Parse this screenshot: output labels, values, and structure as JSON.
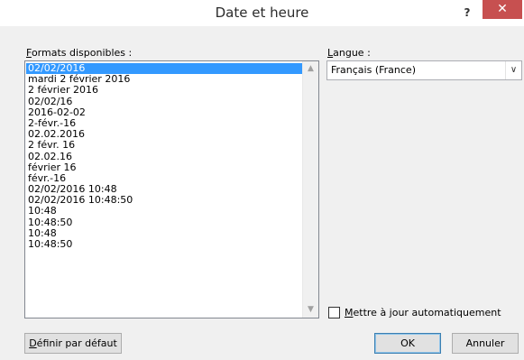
{
  "window": {
    "title": "Date et heure",
    "help_glyph": "?",
    "close_glyph": "✕"
  },
  "formats": {
    "label_accel": "F",
    "label_rest": "ormats disponibles :",
    "items": [
      "02/02/2016",
      "mardi 2 février 2016",
      "2 février 2016",
      "02/02/16",
      "2016-02-02",
      "2-févr.-16",
      "02.02.2016",
      "2 févr. 16",
      "02.02.16",
      "février 16",
      "févr.-16",
      "02/02/2016 10:48",
      "02/02/2016 10:48:50",
      "10:48",
      "10:48:50",
      "10:48",
      "10:48:50"
    ],
    "selected_index": 0
  },
  "language": {
    "label_accel": "L",
    "label_rest": "angue :",
    "value": "Français (France)"
  },
  "auto_update": {
    "label_accel": "M",
    "label_rest": "ettre à jour automatiquement",
    "checked": false
  },
  "buttons": {
    "default_accel": "D",
    "default_rest": "éfinir par défaut",
    "ok": "OK",
    "cancel": "Annuler"
  },
  "colors": {
    "selection": "#3399ff",
    "close_button": "#c75050"
  }
}
